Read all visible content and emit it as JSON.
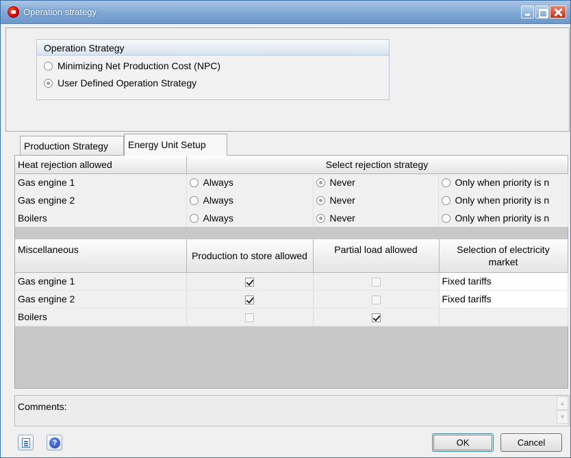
{
  "window": {
    "title": "Operation strategy"
  },
  "strategy": {
    "header": "Operation Strategy",
    "options": [
      {
        "label": "Minimizing Net Production Cost (NPC)",
        "selected": false
      },
      {
        "label": "User Defined Operation Strategy",
        "selected": true
      }
    ]
  },
  "tabs": [
    {
      "label": "Production Strategy",
      "active": false
    },
    {
      "label": "Energy Unit Setup",
      "active": true
    }
  ],
  "heat_rejection": {
    "col1_header": "Heat rejection allowed",
    "col2_header": "Select rejection strategy",
    "options": [
      "Always",
      "Never",
      "Only when priority is n"
    ],
    "rows": [
      {
        "unit": "Gas engine 1",
        "selected": "Never"
      },
      {
        "unit": "Gas engine 2",
        "selected": "Never"
      },
      {
        "unit": "Boilers",
        "selected": "Never"
      }
    ]
  },
  "misc": {
    "headers": [
      "Miscellaneous",
      "Production to store allowed",
      "Partial load allowed",
      "Selection of electricity market"
    ],
    "rows": [
      {
        "unit": "Gas engine 1",
        "store": true,
        "partial": false,
        "market": "Fixed tariffs"
      },
      {
        "unit": "Gas engine 2",
        "store": true,
        "partial": false,
        "market": "Fixed tariffs"
      },
      {
        "unit": "Boilers",
        "store": false,
        "partial": true,
        "market": ""
      }
    ]
  },
  "comments": {
    "label": "Comments:"
  },
  "buttons": {
    "ok": "OK",
    "cancel": "Cancel"
  },
  "icons": {
    "notes": "document-icon",
    "help": "help-icon"
  }
}
